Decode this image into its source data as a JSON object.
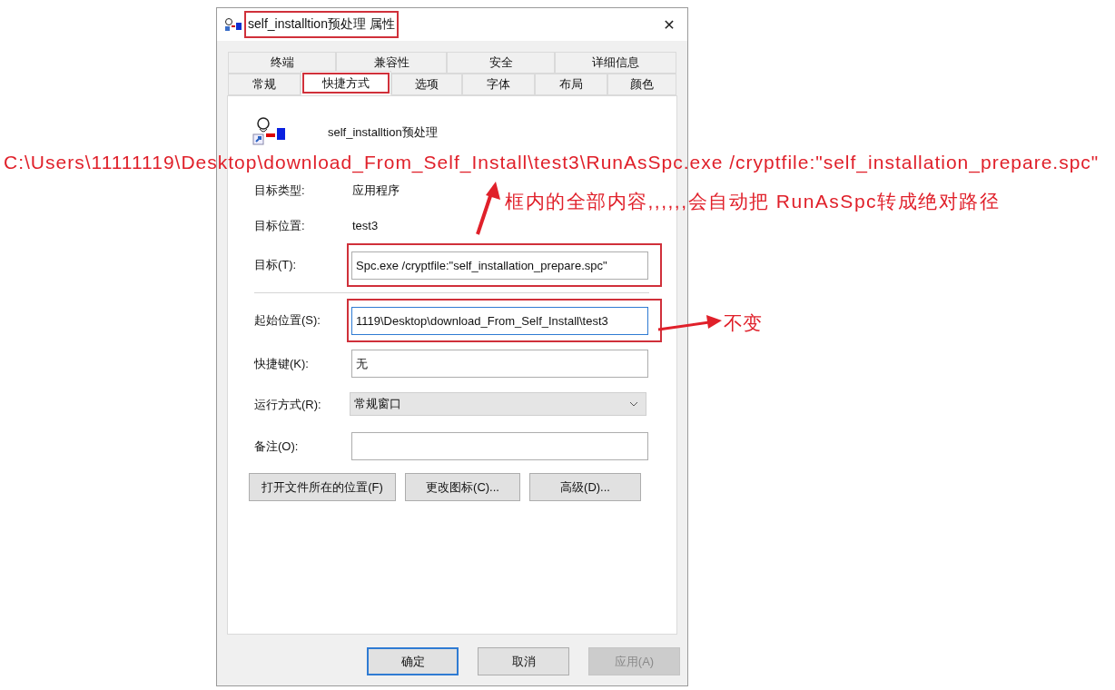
{
  "window": {
    "title": "self_installtion预处理 属性",
    "title_highlighted": true,
    "close": "✕"
  },
  "tab_rows": [
    {
      "tabs": [
        {
          "label": "终端",
          "selected": false,
          "highlighted": false
        },
        {
          "label": "兼容性",
          "selected": false,
          "highlighted": false
        },
        {
          "label": "安全",
          "selected": false,
          "highlighted": false
        },
        {
          "label": "详细信息",
          "selected": false,
          "highlighted": false
        }
      ]
    },
    {
      "tabs": [
        {
          "label": "常规",
          "selected": false,
          "highlighted": false
        },
        {
          "label": "快捷方式",
          "selected": true,
          "highlighted": true
        },
        {
          "label": "选项",
          "selected": false,
          "highlighted": false
        },
        {
          "label": "字体",
          "selected": false,
          "highlighted": false
        },
        {
          "label": "布局",
          "selected": false,
          "highlighted": false
        },
        {
          "label": "颜色",
          "selected": false,
          "highlighted": false
        }
      ]
    }
  ],
  "shortcut_name": "self_installtion预处理",
  "fields": [
    {
      "kind": "info",
      "label": "目标类型:",
      "value": "应用程序"
    },
    {
      "kind": "info",
      "label": "目标位置:",
      "value": "test3"
    },
    {
      "kind": "input",
      "label": "目标(T):",
      "value": "Spc.exe /cryptfile:\"self_installation_prepare.spc\"",
      "highlighted": true,
      "focused": false
    },
    {
      "kind": "separator"
    },
    {
      "kind": "input",
      "label": "起始位置(S):",
      "value": "1119\\Desktop\\download_From_Self_Install\\test3",
      "highlighted": true,
      "focused": true
    },
    {
      "kind": "input",
      "label": "快捷键(K):",
      "value": "无",
      "highlighted": false,
      "focused": false
    },
    {
      "kind": "select",
      "label": "运行方式(R):",
      "value": "常规窗口"
    },
    {
      "kind": "input",
      "label": "备注(O):",
      "highlighted": false,
      "focused": false
    }
  ],
  "action_buttons": [
    "打开文件所在的位置(F)",
    "更改图标(C)...",
    "高级(D)..."
  ],
  "footer_buttons": [
    {
      "label": "确定",
      "default": true,
      "disabled": false
    },
    {
      "label": "取消",
      "default": false,
      "disabled": false
    },
    {
      "label": "应用(A)",
      "default": false,
      "disabled": true
    }
  ],
  "annotations": {
    "full_path": "C:\\Users\\11111119\\Desktop\\download_From_Self_Install\\test3\\RunAsSpc.exe /cryptfile:\"self_installation_prepare.spc\"",
    "target_note": "框内的全部内容,,,,,,会自动把 RunAsSpc转成绝对路径",
    "start_note": "不变"
  }
}
